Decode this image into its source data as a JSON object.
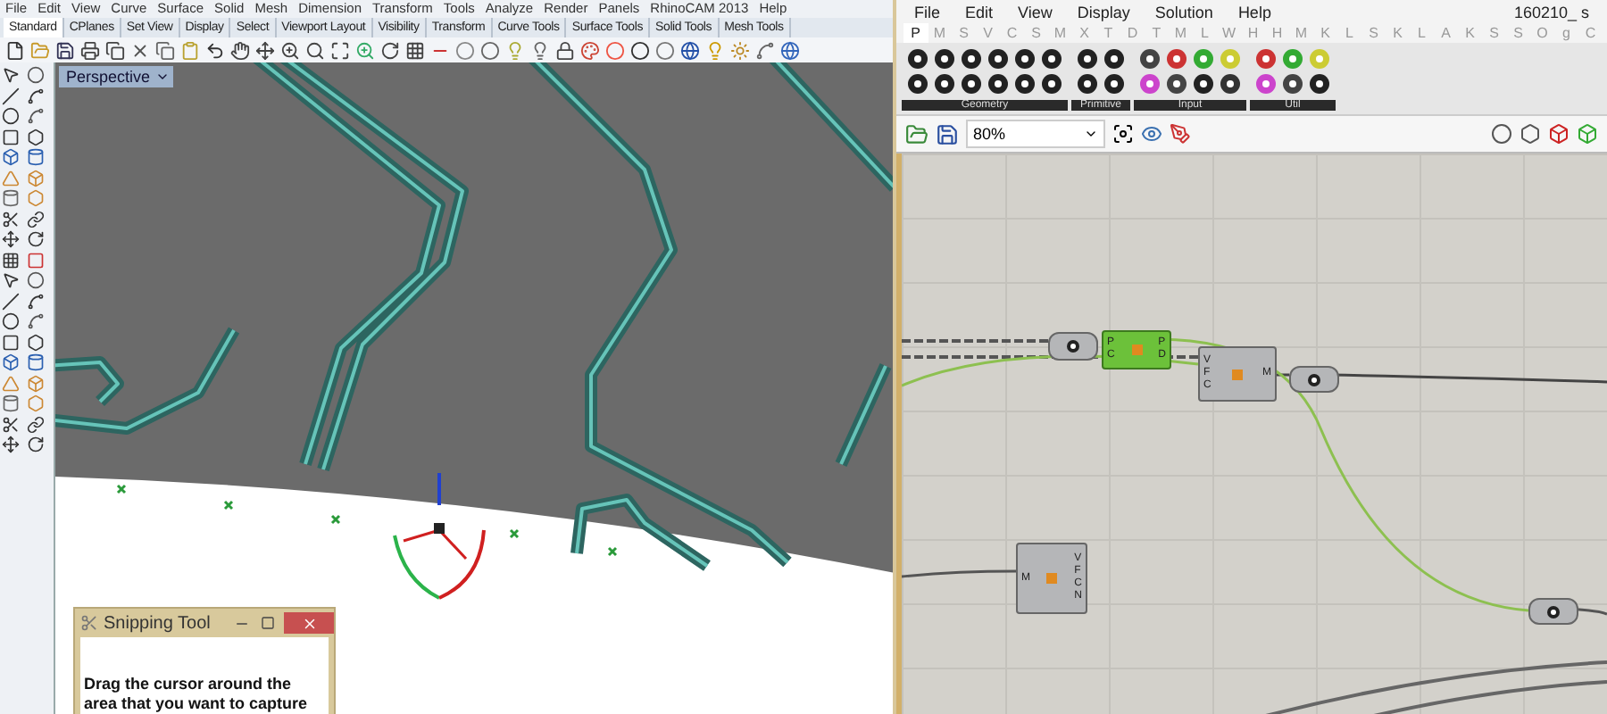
{
  "rhino": {
    "menu": [
      "File",
      "Edit",
      "View",
      "Curve",
      "Surface",
      "Solid",
      "Mesh",
      "Dimension",
      "Transform",
      "Tools",
      "Analyze",
      "Render",
      "Panels",
      "RhinoCAM 2013",
      "Help"
    ],
    "tabs": [
      {
        "label": "Standard",
        "selected": true
      },
      {
        "label": "CPlanes",
        "selected": false
      },
      {
        "label": "Set View",
        "selected": false
      },
      {
        "label": "Display",
        "selected": false
      },
      {
        "label": "Select",
        "selected": false
      },
      {
        "label": "Viewport Layout",
        "selected": false
      },
      {
        "label": "Visibility",
        "selected": false
      },
      {
        "label": "Transform",
        "selected": false
      },
      {
        "label": "Curve Tools",
        "selected": false
      },
      {
        "label": "Surface Tools",
        "selected": false
      },
      {
        "label": "Solid Tools",
        "selected": false
      },
      {
        "label": "Mesh Tools",
        "selected": false
      }
    ],
    "viewport": {
      "label": "Perspective"
    }
  },
  "snipping_tool": {
    "title": "Snipping Tool",
    "message": "Drag the cursor around the area that you want to capture"
  },
  "grasshopper": {
    "menu": [
      "File",
      "Edit",
      "View",
      "Display",
      "Solution",
      "Help"
    ],
    "document_title": "160210_ s",
    "category_tabs": [
      {
        "label": "P",
        "selected": true
      },
      {
        "label": "M",
        "selected": false
      },
      {
        "label": "S",
        "selected": false
      },
      {
        "label": "V",
        "selected": false
      },
      {
        "label": "C",
        "selected": false
      },
      {
        "label": "S",
        "selected": false
      },
      {
        "label": "M",
        "selected": false
      },
      {
        "label": "X",
        "selected": false
      },
      {
        "label": "T",
        "selected": false
      },
      {
        "label": "D",
        "selected": false
      },
      {
        "label": "T",
        "selected": false
      },
      {
        "label": "M",
        "selected": false
      },
      {
        "label": "L",
        "selected": false
      },
      {
        "label": "W",
        "selected": false
      },
      {
        "label": "H",
        "selected": false
      },
      {
        "label": "H",
        "selected": false
      },
      {
        "label": "M",
        "selected": false
      },
      {
        "label": "K",
        "selected": false
      },
      {
        "label": "L",
        "selected": false
      },
      {
        "label": "S",
        "selected": false
      },
      {
        "label": "K",
        "selected": false
      },
      {
        "label": "L",
        "selected": false
      },
      {
        "label": "A",
        "selected": false
      },
      {
        "label": "K",
        "selected": false
      },
      {
        "label": "S",
        "selected": false
      },
      {
        "label": "S",
        "selected": false
      },
      {
        "label": "O",
        "selected": false
      },
      {
        "label": "g",
        "selected": false
      },
      {
        "label": "C",
        "selected": false
      }
    ],
    "panels": [
      "Geometry",
      "Primitive",
      "Input",
      "Util"
    ],
    "zoom": "80%",
    "nodes": [
      {
        "kind": "param",
        "selected": false
      },
      {
        "kind": "component",
        "selected": true,
        "inputs": [
          "P",
          "C"
        ],
        "outputs": [
          "P",
          "D"
        ]
      },
      {
        "kind": "component",
        "selected": false,
        "inputs": [
          "V",
          "F",
          "C"
        ],
        "outputs": [
          "M"
        ]
      },
      {
        "kind": "param",
        "selected": false
      },
      {
        "kind": "component",
        "selected": false,
        "inputs": [
          "M"
        ],
        "outputs": [
          "V",
          "F",
          "C",
          "N"
        ]
      },
      {
        "kind": "param",
        "selected": false
      }
    ]
  }
}
